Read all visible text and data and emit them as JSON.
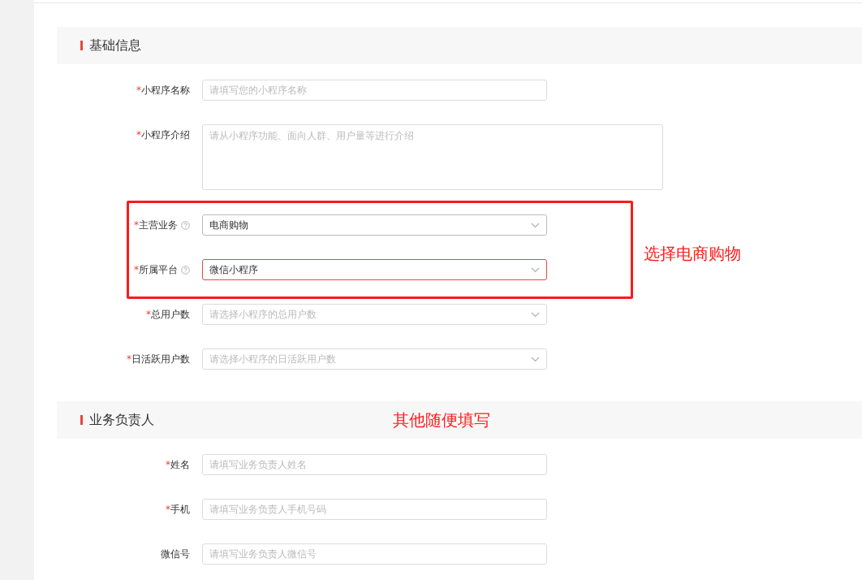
{
  "sections": [
    {
      "title": "基础信息",
      "fields": [
        {
          "kind": "text",
          "asterisk": "*",
          "label": "小程序名称",
          "help": false,
          "invalid": false,
          "placeholder": "请填写您的小程序名称"
        },
        {
          "kind": "textarea",
          "asterisk": "*",
          "label": "小程序介绍",
          "help": false,
          "invalid": false,
          "placeholder": "请从小程序功能、面向人群、用户量等进行介绍"
        },
        {
          "kind": "select",
          "asterisk": "*",
          "label": "主营业务",
          "help": true,
          "invalid": false,
          "value": "电商购物"
        },
        {
          "kind": "select",
          "asterisk": "*",
          "label": "所属平台",
          "help": true,
          "invalid": true,
          "value": "微信小程序"
        },
        {
          "kind": "select",
          "asterisk": "*",
          "label": "总用户数",
          "help": false,
          "invalid": false,
          "placeholder": "请选择小程序的总用户数"
        },
        {
          "kind": "select",
          "asterisk": "*",
          "label": "日活跃用户数",
          "help": false,
          "invalid": false,
          "placeholder": "请选择小程序的日活跃用户数"
        }
      ]
    },
    {
      "title": "业务负责人",
      "fields": [
        {
          "kind": "text",
          "asterisk": "*",
          "label": "姓名",
          "help": false,
          "invalid": false,
          "placeholder": "请填写业务负责人姓名"
        },
        {
          "kind": "text",
          "asterisk": "*",
          "label": "手机",
          "help": false,
          "invalid": false,
          "placeholder": "请填写业务负责人手机号码"
        },
        {
          "kind": "text",
          "label": "微信号",
          "help": false,
          "invalid": false,
          "placeholder": "请填写业务负责人微信号"
        }
      ]
    }
  ],
  "annotations": [
    {
      "kind": "box"
    },
    {
      "kind": "note",
      "text": "选择电商购物"
    },
    {
      "kind": "note",
      "text": "其他随便填写"
    }
  ]
}
